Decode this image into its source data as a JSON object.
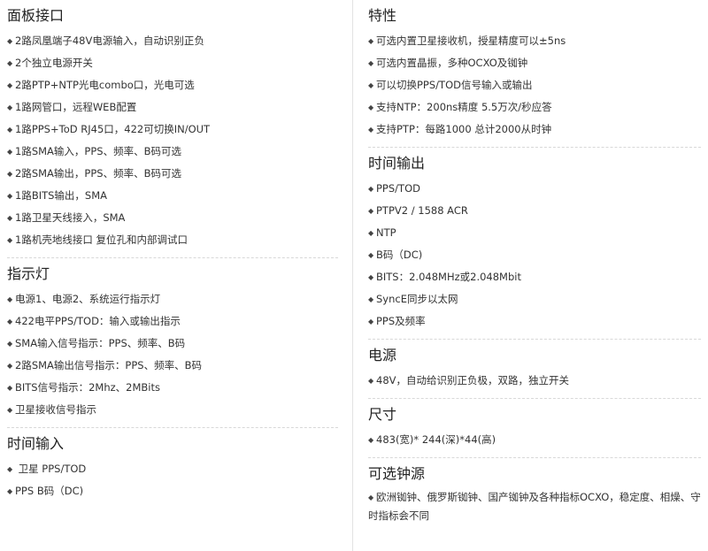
{
  "left": {
    "sections": [
      {
        "title": "面板接口",
        "items": [
          "2路凤凰端子48V电源输入，自动识别正负",
          "2个独立电源开关",
          "2路PTP+NTP光电combo口，光电可选",
          "1路网管口，远程WEB配置",
          "1路PPS+ToD RJ45口，422可切换IN/OUT",
          "1路SMA输入，PPS、频率、B码可选",
          "2路SMA输出，PPS、频率、B码可选",
          "1路BITS输出，SMA",
          "1路卫星天线接入，SMA",
          "1路机壳地线接口 复位孔和内部调试口"
        ]
      },
      {
        "title": "指示灯",
        "items": [
          "电源1、电源2、系统运行指示灯",
          "422电平PPS/TOD：输入或输出指示",
          "SMA输入信号指示：PPS、频率、B码",
          "2路SMA输出信号指示：PPS、频率、B码",
          "BITS信号指示：2Mhz、2MBits",
          "卫星接收信号指示"
        ]
      },
      {
        "title": "时间输入",
        "items": [
          " 卫星 PPS/TOD",
          "PPS B码（DC)"
        ]
      }
    ]
  },
  "right": {
    "sections": [
      {
        "title": "特性",
        "items": [
          "可选内置卫星接收机，授星精度可以±5ns",
          "可选内置晶振，多种OCXO及铷钟",
          "可以切换PPS/TOD信号输入或输出",
          "支持NTP：200ns精度 5.5万次/秒应答",
          "支持PTP：每路1000 总计2000从时钟"
        ]
      },
      {
        "title": "时间输出",
        "items": [
          "PPS/TOD",
          "PTPV2 / 1588 ACR",
          "NTP",
          "B码（DC)",
          "BITS：2.048MHz或2.048Mbit",
          "SyncE同步以太网",
          "PPS及频率"
        ]
      },
      {
        "title": "电源",
        "items": [
          "48V，自动给识别正负极，双路，独立开关"
        ]
      },
      {
        "title": "尺寸",
        "items": [
          "483(宽)* 244(深)*44(高)"
        ]
      },
      {
        "title": "可选钟源",
        "items": [
          "欧洲铷钟、俄罗斯铷钟、国产铷钟及各种指标OCXO，稳定度、相燥、守时指标会不同"
        ]
      }
    ]
  }
}
